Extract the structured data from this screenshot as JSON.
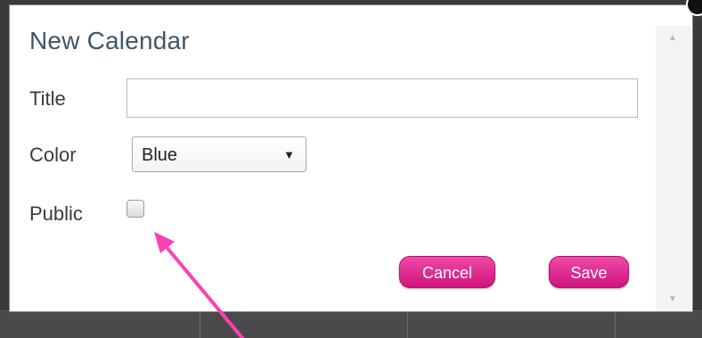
{
  "dialog": {
    "title": "New Calendar",
    "fields": {
      "title_label": "Title",
      "title_value": "",
      "color_label": "Color",
      "color_selected": "Blue",
      "public_label": "Public",
      "public_checked": false
    },
    "buttons": {
      "cancel_label": "Cancel",
      "save_label": "Save"
    }
  },
  "colors": {
    "button_pink": "#e0288f",
    "title_text": "#3f5668",
    "annotation_arrow": "#ff3fb4"
  },
  "icons": {
    "close": "close-icon",
    "caret": "caret-down-icon",
    "scroll_up": "scroll-up-icon",
    "scroll_down": "scroll-down-icon"
  }
}
